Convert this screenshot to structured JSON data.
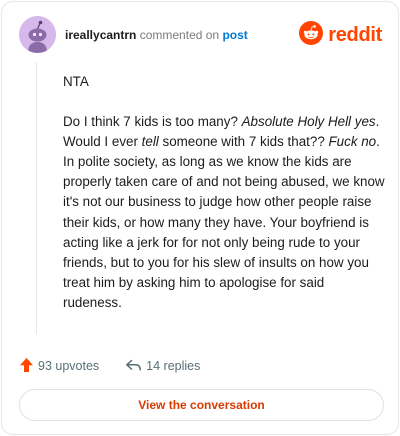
{
  "comment": {
    "author": "ireallycantrn",
    "action_text": "commented on",
    "link_text": "post",
    "paragraphs": [
      [
        {
          "t": "NTA"
        }
      ],
      [
        {
          "t": "Do I think 7 kids is too many? "
        },
        {
          "t": "Absolute Holy Hell yes",
          "em": true
        },
        {
          "t": ". Would I ever "
        },
        {
          "t": "tell",
          "em": true
        },
        {
          "t": " someone with 7 kids that?? "
        },
        {
          "t": "Fuck no",
          "em": true
        },
        {
          "t": ". In polite society, as long as we know the kids are properly taken care of and not being abused, we know it's not our business to judge how other people raise their kids, or how many they have. Your boyfriend is acting like a jerk for for not only being rude to your friends, but to you for his slew of insults on how you treat him by asking him to apologise for said rudeness."
        }
      ]
    ]
  },
  "brand": {
    "wordmark": "reddit",
    "color": "#ff4500"
  },
  "stats": {
    "upvotes": "93 upvotes",
    "replies": "14 replies"
  },
  "cta": {
    "label": "View the conversation",
    "color": "#d93a00"
  },
  "icons": {
    "avatar": "snoo-avatar-icon",
    "logo": "reddit-logo-icon",
    "upvote": "upvote-arrow-icon",
    "reply": "reply-arrow-icon"
  }
}
